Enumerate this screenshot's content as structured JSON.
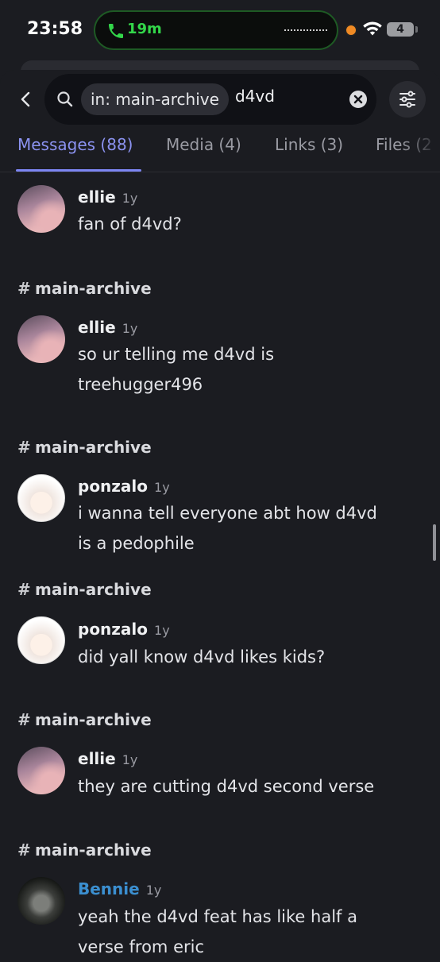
{
  "status_bar": {
    "time": "23:58",
    "call_duration": "19m",
    "battery": "4"
  },
  "search": {
    "channel_filter": "in: main-archive",
    "query": "d4vd"
  },
  "tabs": [
    {
      "label": "Messages (88)",
      "active": true
    },
    {
      "label": "Media (4)",
      "active": false
    },
    {
      "label": "Links (3)",
      "active": false
    },
    {
      "label": "Files (2",
      "active": false
    }
  ],
  "results": [
    {
      "channel": "",
      "author": "ellie",
      "timestamp": "1y",
      "lines": [
        "fan of d4vd?"
      ],
      "avatar": "ellie"
    },
    {
      "channel": "main-archive",
      "author": "ellie",
      "timestamp": "1y",
      "lines": [
        "so ur telling me d4vd is",
        "treehugger496"
      ],
      "avatar": "ellie"
    },
    {
      "channel": "main-archive",
      "author": "ponzalo",
      "timestamp": "1y",
      "lines": [
        "i wanna tell everyone abt how d4vd",
        "is a pedophile"
      ],
      "avatar": "ponzalo"
    },
    {
      "channel": "main-archive",
      "author": "ponzalo",
      "timestamp": "1y",
      "lines": [
        "did yall know d4vd likes kids?"
      ],
      "avatar": "ponzalo"
    },
    {
      "channel": "main-archive",
      "author": "ellie",
      "timestamp": "1y",
      "lines": [
        "they are cutting d4vd second verse"
      ],
      "avatar": "ellie"
    },
    {
      "channel": "main-archive",
      "author": "Bennie",
      "timestamp": "1y",
      "lines": [
        "yeah the d4vd feat has like half a",
        "verse from eric"
      ],
      "avatar": "bennie"
    }
  ],
  "icons": [
    "phone-icon",
    "wifi-icon",
    "back-chevron-icon",
    "search-icon",
    "clear-icon",
    "filter-sliders-icon",
    "channel-hash-icon"
  ],
  "colors": {
    "background": "#1b1c21",
    "accent": "#7c85f2",
    "call_green": "#33d74a",
    "author_blue": "#3b8fd0"
  }
}
